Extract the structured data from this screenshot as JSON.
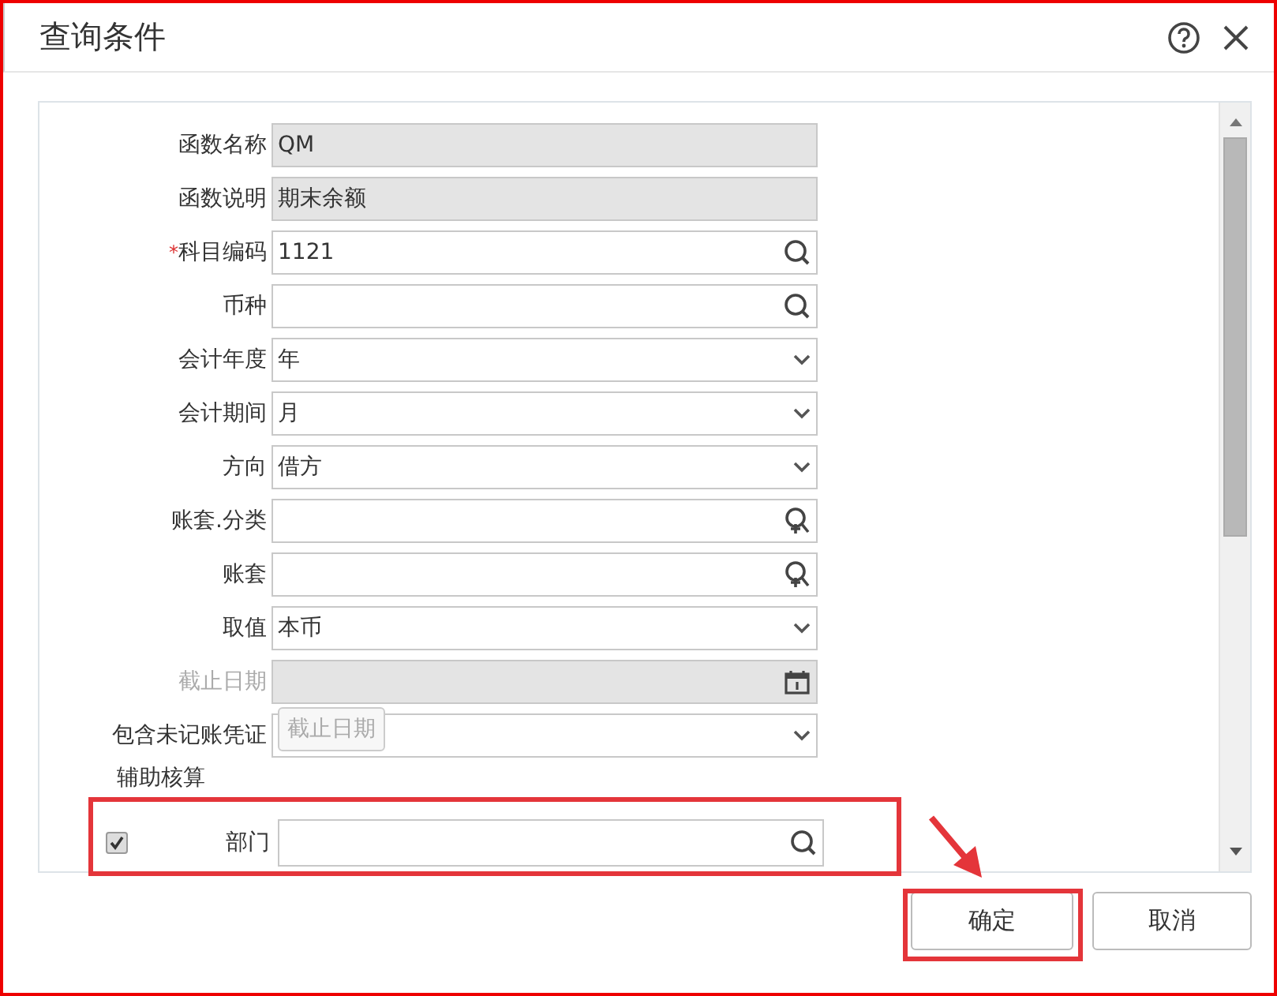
{
  "window": {
    "title": "查询条件"
  },
  "fields": [
    {
      "label": "函数名称",
      "kind": "readonly",
      "value": "QM",
      "disabled": false
    },
    {
      "label": "函数说明",
      "kind": "readonly",
      "value": "期末余额",
      "disabled": false
    },
    {
      "label": "科目编码",
      "required_mark": "*",
      "kind": "lookup",
      "value": "1121",
      "disabled": false
    },
    {
      "label": "币种",
      "kind": "lookup",
      "disabled": false
    },
    {
      "label": "会计年度",
      "kind": "select",
      "value": "年",
      "disabled": false
    },
    {
      "label": "会计期间",
      "kind": "select",
      "value": "月",
      "disabled": false
    },
    {
      "label": "方向",
      "kind": "select",
      "value": "借方",
      "disabled": false
    },
    {
      "label": "账套.分类",
      "kind": "lookup-add",
      "disabled": false
    },
    {
      "label": "账套",
      "kind": "lookup-add",
      "disabled": false
    },
    {
      "label": "取值",
      "kind": "select",
      "value": "本币",
      "disabled": false
    },
    {
      "label": "截止日期",
      "kind": "date",
      "disabled": true
    },
    {
      "label": "包含未记账凭证",
      "kind": "select",
      "disabled": false,
      "tooltip": "截止日期"
    }
  ],
  "auxiliary": {
    "title": "辅助核算",
    "rows": [
      {
        "label": "部门",
        "checked": true
      }
    ]
  },
  "buttons": [
    {
      "label": "确定",
      "kind": "primary"
    },
    {
      "label": "取消",
      "kind": "secondary"
    }
  ]
}
